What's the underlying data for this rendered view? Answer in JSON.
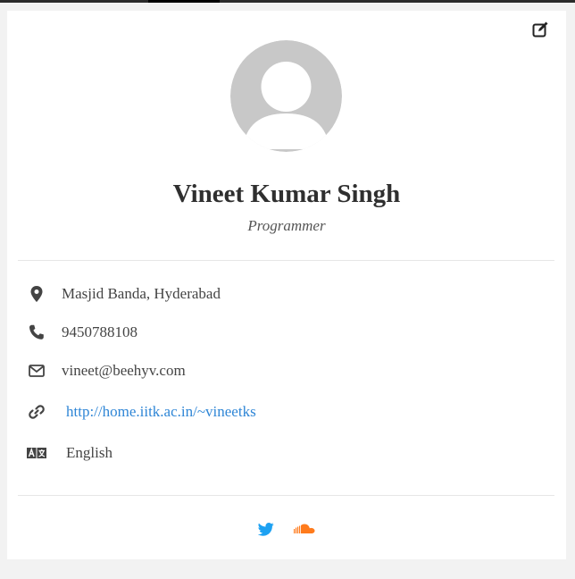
{
  "profile": {
    "name": "Vineet Kumar Singh",
    "title": "Programmer"
  },
  "details": {
    "location": "Masjid Banda, Hyderabad",
    "phone": "9450788108",
    "email": "vineet@beehyv.com",
    "website": "http://home.iitk.ac.in/~vineetks",
    "language": "English"
  },
  "icons": {
    "edit": "edit-icon",
    "avatar": "user-avatar-placeholder",
    "location": "map-marker-icon",
    "phone": "phone-icon",
    "email": "envelope-icon",
    "website": "link-icon",
    "language": "language-icon",
    "twitter": "twitter-icon",
    "soundcloud": "soundcloud-icon"
  },
  "colors": {
    "link": "#2f86d6",
    "twitter": "#1da1f2",
    "soundcloud": "#ff7b1c",
    "avatar_bg": "#c8c8c8"
  }
}
